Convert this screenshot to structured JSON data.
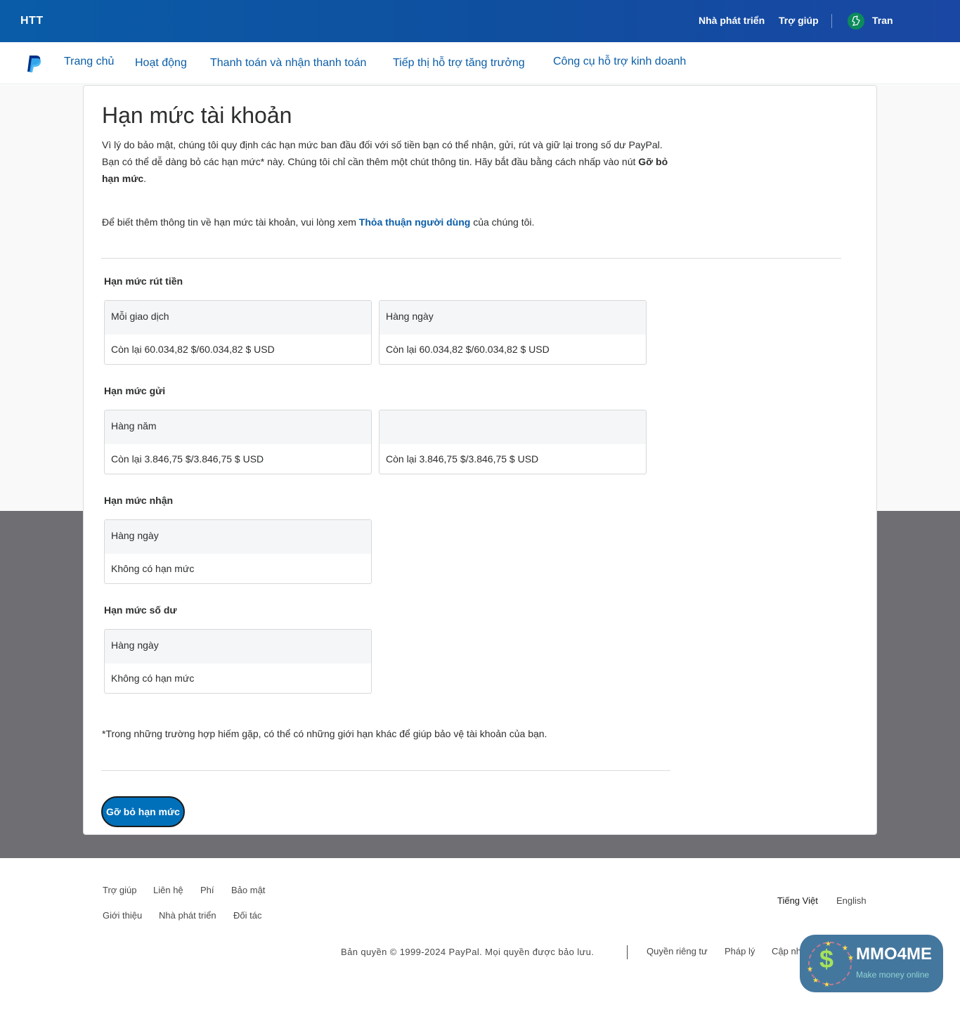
{
  "topbar": {
    "brand": "HTT",
    "developer_link": "Nhà phát triển",
    "help_link": "Trợ giúp",
    "user_name": "Tran",
    "avatar_icon": "profile-avatar-icon"
  },
  "nav": {
    "logo_icon": "paypal-logo-icon",
    "items": [
      {
        "label": "Trang chủ"
      },
      {
        "label": "Hoạt động"
      },
      {
        "label": "Thanh toán và nhận thanh toán"
      },
      {
        "label": "Tiếp thị hỗ trợ tăng trưởng"
      },
      {
        "label": "Công cụ hỗ trợ kinh doanh"
      }
    ]
  },
  "page": {
    "title": "Hạn mức tài khoản",
    "intro_text": "Vì lý do bảo mật, chúng tôi quy định các hạn mức ban đầu đối với số tiền bạn có thể nhận, gửi, rút và giữ lại trong số dư PayPal. Bạn có thể dễ dàng bỏ các hạn mức* này. Chúng tôi chỉ cần thêm một chút thông tin. Hãy bắt đầu bằng cách nhấp vào nút ",
    "intro_bold": "Gỡ bỏ hạn mức",
    "intro_end": ".",
    "more_prefix": "Để biết thêm thông tin về hạn mức tài khoản, vui lòng xem ",
    "more_link": "Thỏa thuận người dùng",
    "more_suffix": " của chúng tôi.",
    "sections": [
      {
        "heading": "Hạn mức rút tiền",
        "boxes": [
          {
            "period": "Mỗi giao dịch",
            "value": "Còn lại 60.034,82 $/60.034,82 $ USD"
          },
          {
            "period": "Hàng ngày",
            "value": "Còn lại 60.034,82 $/60.034,82 $ USD"
          }
        ]
      },
      {
        "heading": "Hạn mức gửi",
        "boxes": [
          {
            "period": "Hàng năm",
            "value": "Còn lại 3.846,75 $/3.846,75 $ USD"
          },
          {
            "period": "",
            "value": "Còn lại 3.846,75 $/3.846,75 $ USD"
          }
        ]
      },
      {
        "heading": "Hạn mức nhận",
        "boxes": [
          {
            "period": "Hàng ngày",
            "value": "Không có hạn mức"
          }
        ]
      },
      {
        "heading": "Hạn mức số dư",
        "boxes": [
          {
            "period": "Hàng ngày",
            "value": "Không có hạn mức"
          }
        ]
      }
    ],
    "footnote": "*Trong những trường hợp hiếm gặp, có thể có những giới hạn khác để giúp bảo vệ tài khoản của bạn.",
    "cta_label": "Gỡ bỏ hạn mức"
  },
  "footer": {
    "links_row1": [
      "Trợ giúp",
      "Liên hệ",
      "Phí",
      "Bảo mật"
    ],
    "links_row2": [
      "Giới thiệu",
      "Nhà phát triển",
      "Đối tác"
    ],
    "lang_active": "Tiếng Việt",
    "lang_other": "English",
    "copyright": "Bản quyền © 1999-2024 PayPal. Mọi quyền được bảo lưu.",
    "legal_links": [
      "Quyền riêng tư",
      "Pháp lý",
      "Cập nhật về chính sách"
    ]
  },
  "watermark": {
    "name": "MMO4ME",
    "tagline": "Make money online",
    "symbol": "$"
  },
  "colors": {
    "topbar_blue": "#0f4fa0",
    "link_blue": "#0b5ea8",
    "button_blue": "#0070ba",
    "dark_band": "#6f6e72"
  }
}
